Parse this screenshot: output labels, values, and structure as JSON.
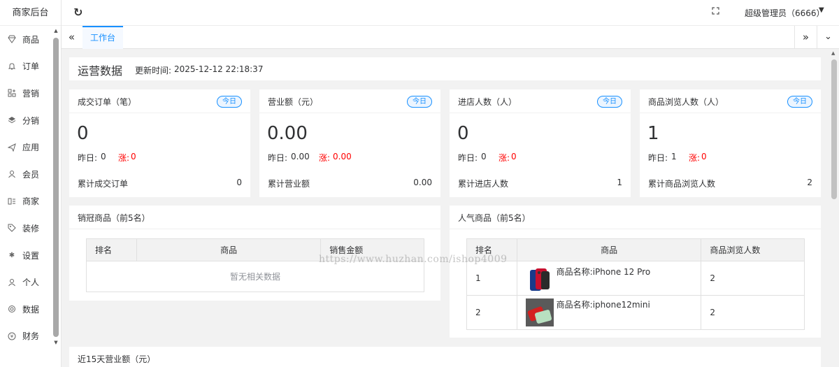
{
  "brand": "商家后台",
  "sidebar": {
    "items": [
      {
        "label": "商品",
        "icon": "diamond-icon"
      },
      {
        "label": "订单",
        "icon": "bell-icon"
      },
      {
        "label": "营销",
        "icon": "grid-plus-icon"
      },
      {
        "label": "分销",
        "icon": "layers-icon"
      },
      {
        "label": "应用",
        "icon": "send-icon"
      },
      {
        "label": "会员",
        "icon": "user-icon"
      },
      {
        "label": "商家",
        "icon": "shop-icon"
      },
      {
        "label": "装修",
        "icon": "tag-icon"
      },
      {
        "label": "设置",
        "icon": "gear-icon"
      },
      {
        "label": "个人",
        "icon": "person-icon"
      },
      {
        "label": "数据",
        "icon": "globe-icon"
      },
      {
        "label": "财务",
        "icon": "yen-icon"
      }
    ]
  },
  "header": {
    "user": "超级管理员（6666）"
  },
  "tabs": {
    "active": "工作台"
  },
  "ops": {
    "title": "运营数据",
    "update_label": "更新时间:",
    "update_time": "2025-12-12 22:18:37"
  },
  "stats": [
    {
      "title": "成交订单（笔）",
      "badge": "今日",
      "value": "0",
      "yesterday_label": "昨日:",
      "yesterday": "0",
      "rise_label": "涨:",
      "rise": "0",
      "total_label": "累计成交订单",
      "total": "0"
    },
    {
      "title": "营业额（元）",
      "badge": "今日",
      "value": "0.00",
      "yesterday_label": "昨日:",
      "yesterday": "0.00",
      "rise_label": "涨:",
      "rise": "0.00",
      "total_label": "累计营业额",
      "total": "0.00"
    },
    {
      "title": "进店人数（人）",
      "badge": "今日",
      "value": "0",
      "yesterday_label": "昨日:",
      "yesterday": "0",
      "rise_label": "涨:",
      "rise": "0",
      "total_label": "累计进店人数",
      "total": "1"
    },
    {
      "title": "商品浏览人数（人）",
      "badge": "今日",
      "value": "1",
      "yesterday_label": "昨日:",
      "yesterday": "1",
      "rise_label": "涨:",
      "rise": "0",
      "total_label": "累计商品浏览人数",
      "total": "2"
    }
  ],
  "top_sales": {
    "title": "销冠商品（前5名）",
    "columns": [
      "排名",
      "商品",
      "销售金额"
    ],
    "empty": "暂无相关数据"
  },
  "popular": {
    "title": "人气商品（前5名）",
    "columns": [
      "排名",
      "商品",
      "商品浏览人数"
    ],
    "rows": [
      {
        "rank": "1",
        "name": "商品名称:iPhone 12 Pro",
        "views": "2"
      },
      {
        "rank": "2",
        "name": "商品名称:iphone12mini",
        "views": "2"
      }
    ]
  },
  "revenue_15d": {
    "title": "近15天营业额（元）"
  },
  "watermark": "https://www.huzhan.com/ishop4009",
  "colors": {
    "accent": "#1890ff",
    "rise": "#ff0000",
    "background": "#f2f2f2"
  }
}
